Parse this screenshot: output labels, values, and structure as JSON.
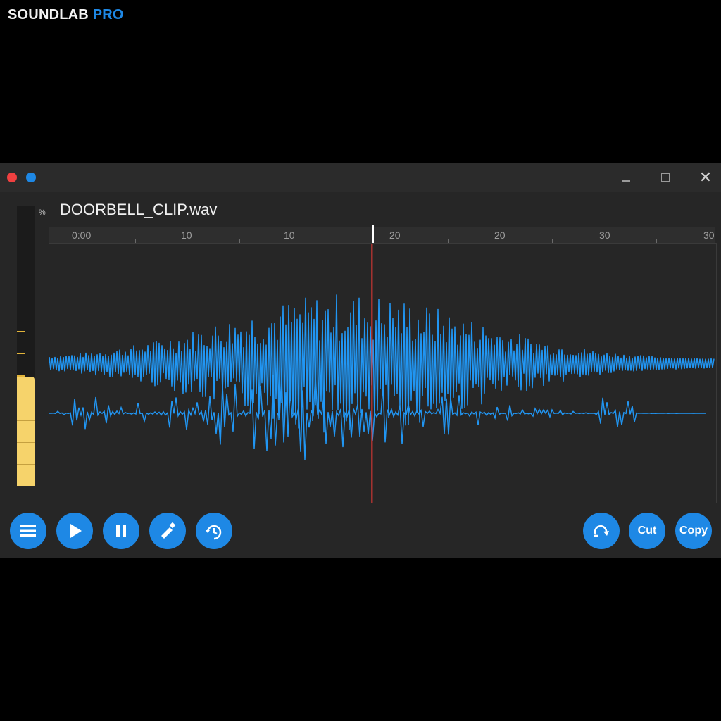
{
  "app": {
    "brand_main": "SOUNDLAB",
    "brand_accent": "PRO"
  },
  "colors": {
    "accent": "#1e88e5",
    "playhead": "#e53935",
    "waveform": "#2196f3",
    "meter": "#f6d36b",
    "meter_ticks": "#e2b43a"
  },
  "window": {
    "file_name": "DOORBELL_CLIP.wav",
    "close_glyph": "✕"
  },
  "meter": {
    "unit_label": "%",
    "level": 0.39,
    "tick_levels": [
      0.55,
      0.47,
      0.39
    ]
  },
  "ruler": {
    "labels": [
      "0:00",
      "10",
      "10",
      "20",
      "20",
      "30",
      "30"
    ]
  },
  "playback": {
    "position": 0.484
  },
  "toolbar": {
    "left_icons": [
      "menu-icon",
      "play-icon",
      "pause-icon",
      "edit-icon",
      "timer-icon"
    ],
    "right_icons": [
      "loop-icon"
    ],
    "cut_label": "Cut",
    "copy_label": "Copy"
  }
}
